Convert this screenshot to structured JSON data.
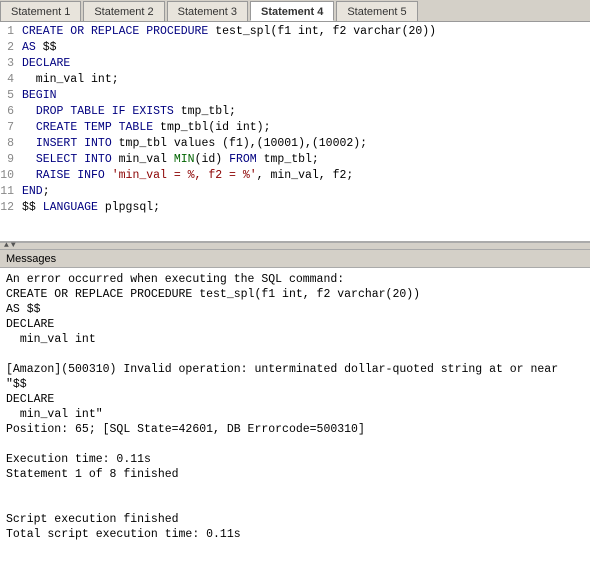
{
  "tabs": [
    {
      "id": "stmt1",
      "label": "Statement 1",
      "active": false
    },
    {
      "id": "stmt2",
      "label": "Statement 2",
      "active": false
    },
    {
      "id": "stmt3",
      "label": "Statement 3",
      "active": false
    },
    {
      "id": "stmt4",
      "label": "Statement 4",
      "active": true
    },
    {
      "id": "stmt5",
      "label": "Statement 5",
      "active": false
    }
  ],
  "code": {
    "lines": [
      {
        "num": "1",
        "text": "CREATE OR REPLACE PROCEDURE test_spl(f1 int, f2 varchar(20))"
      },
      {
        "num": "2",
        "text": "AS $$"
      },
      {
        "num": "3",
        "text": "DECLARE"
      },
      {
        "num": "4",
        "text": "  min_val int;"
      },
      {
        "num": "5",
        "text": "BEGIN"
      },
      {
        "num": "6",
        "text": "  DROP TABLE IF EXISTS tmp_tbl;"
      },
      {
        "num": "7",
        "text": "  CREATE TEMP TABLE tmp_tbl(id int);"
      },
      {
        "num": "8",
        "text": "  INSERT INTO tmp_tbl values (f1),(10001),(10002);"
      },
      {
        "num": "9",
        "text": "  SELECT INTO min_val MIN(id) FROM tmp_tbl;"
      },
      {
        "num": "10",
        "text": "  RAISE INFO 'min_val = %, f2 = %', min_val, f2;"
      },
      {
        "num": "11",
        "text": "END;"
      },
      {
        "num": "12",
        "text": "$$ LANGUAGE plpgsql;"
      }
    ]
  },
  "messages": {
    "label": "Messages",
    "content": "An error occurred when executing the SQL command:\nCREATE OR REPLACE PROCEDURE test_spl(f1 int, f2 varchar(20))\nAS $$\nDECLARE\n  min_val int\n\n[Amazon](500310) Invalid operation: unterminated dollar-quoted string at or near \"$$\nDECLARE\n  min_val int\"\nPosition: 65; [SQL State=42601, DB Errorcode=500310]\n\nExecution time: 0.11s\nStatement 1 of 8 finished\n\n\nScript execution finished\nTotal script execution time: 0.11s"
  }
}
